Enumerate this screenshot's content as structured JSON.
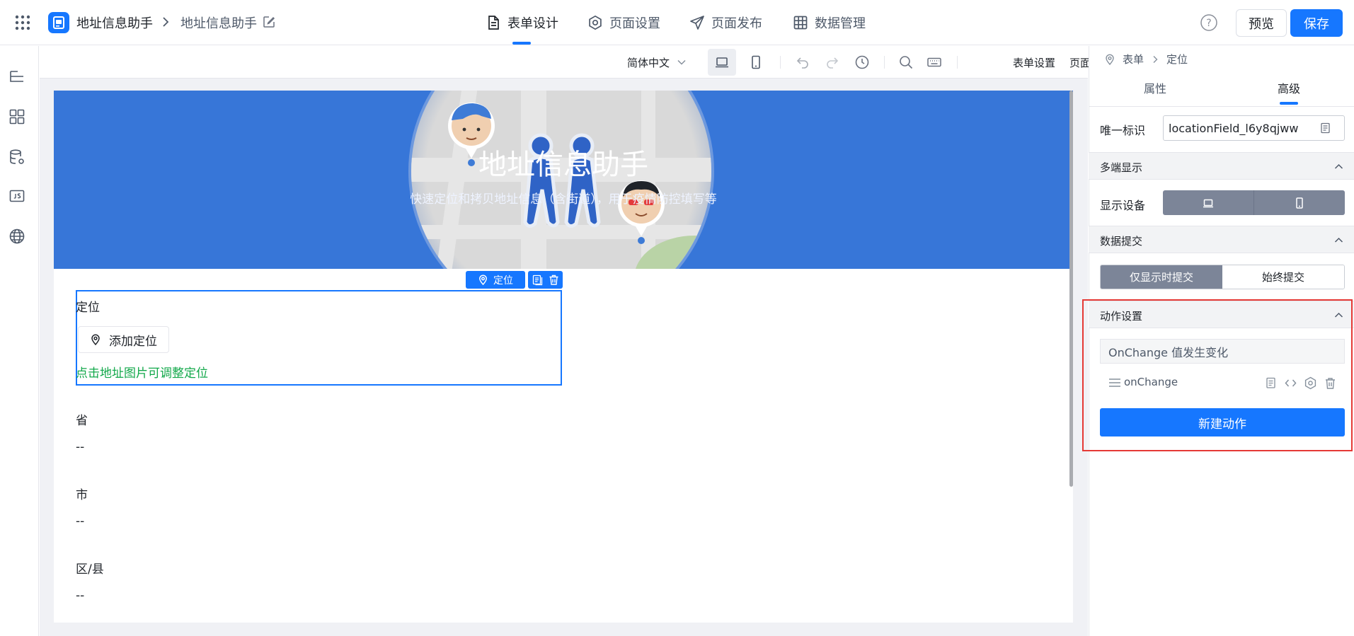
{
  "header": {
    "app_name": "地址信息助手",
    "page_name": "地址信息助手",
    "tabs": [
      {
        "label": "表单设计",
        "icon": "document-icon",
        "active": true
      },
      {
        "label": "页面设置",
        "icon": "gear-icon",
        "active": false
      },
      {
        "label": "页面发布",
        "icon": "paper-plane-icon",
        "active": false
      },
      {
        "label": "数据管理",
        "icon": "table-icon",
        "active": false
      }
    ],
    "help_glyph": "?",
    "preview_label": "预览",
    "save_label": "保存"
  },
  "left_rail": [
    "outline-icon",
    "components-icon",
    "data-source-icon",
    "js-icon",
    "globe-icon"
  ],
  "toolbar": {
    "language": "简体中文",
    "form_settings": "表单设置",
    "page_properties": "页面属性"
  },
  "form": {
    "banner_title": "地址信息助手",
    "banner_subtitle": "快速定位和拷贝地址信息（含街道），用于疫情防控填写等",
    "selected_tag": "定位",
    "location_field": {
      "label": "定位",
      "button_label": "添加定位",
      "hint": "点击地址图片可调整定位"
    },
    "fields": [
      {
        "label": "省",
        "value": "--"
      },
      {
        "label": "市",
        "value": "--"
      },
      {
        "label": "区/县",
        "value": "--"
      }
    ]
  },
  "panel": {
    "breadcrumb": [
      "表单",
      "定位"
    ],
    "tabs": [
      {
        "label": "属性",
        "active": false
      },
      {
        "label": "高级",
        "active": true
      }
    ],
    "unique_id_label": "唯一标识",
    "unique_id_value": "locationField_l6y8qjww",
    "multi_device": {
      "title": "多端显示",
      "label": "显示设备"
    },
    "data_submit": {
      "title": "数据提交",
      "options": [
        "仅显示时提交",
        "始终提交"
      ],
      "selected": "仅显示时提交"
    },
    "actions": {
      "title": "动作设置",
      "event": "OnChange 值发生变化",
      "action_name": "onChange",
      "new_action_label": "新建动作"
    }
  },
  "colors": {
    "primary": "#1677ff",
    "banner": "#3776d8",
    "hint_green": "#12a84a",
    "highlight_red": "#e53935",
    "segment_active": "#7c8598"
  }
}
